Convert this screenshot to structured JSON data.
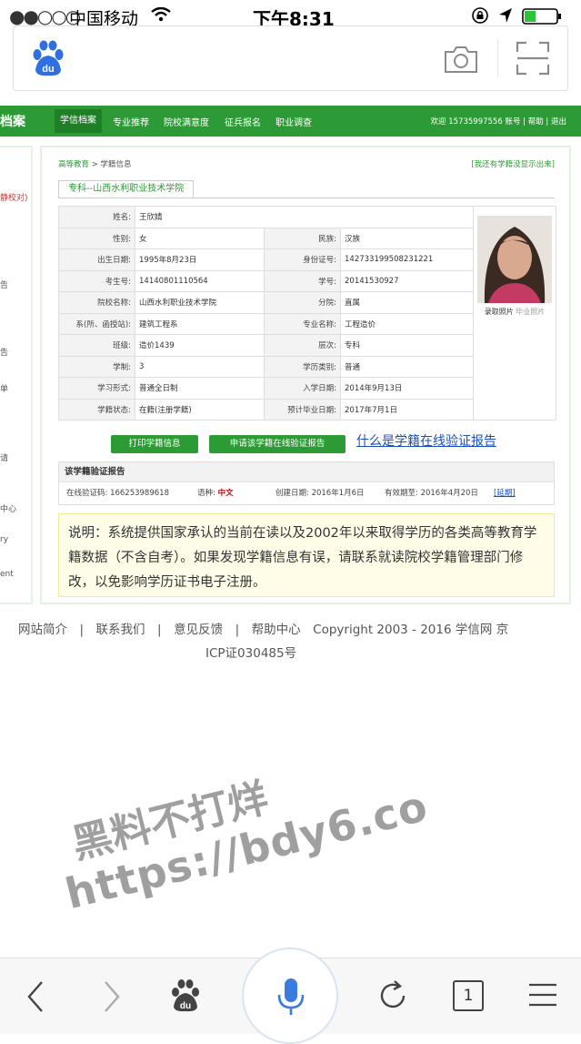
{
  "status_bar": {
    "signal": "●●○○○",
    "carrier": "中国移动",
    "time": "下午8:31"
  },
  "page": {
    "site_name": "档案",
    "nav": [
      "学信档案",
      "专业推荐",
      "院校满意度",
      "征兵报名",
      "职业调查"
    ],
    "user_info": "欢迎 15735997556 账号 | 帮助 | 退出",
    "left_panel": [
      "静校对)",
      "告",
      "告",
      "单",
      "请",
      "中心",
      "ry",
      "ent"
    ],
    "breadcrumb": {
      "home": "高等教育",
      "sep": " > ",
      "current": "学籍信息"
    },
    "no_record_link": "[我还有学籍没显示出来]",
    "school_tab": "专科--山西水利职业技术学院",
    "photo_tabs": {
      "enroll": "录取照片",
      "grad": "毕业照片"
    },
    "rows": [
      {
        "l1": "姓名:",
        "v1": "王欣婧"
      },
      {
        "l1": "性别:",
        "v1": "女",
        "l2": "民族:",
        "v2": "汉族"
      },
      {
        "l1": "出生日期:",
        "v1": "1995年8月23日",
        "l2": "身份证号:",
        "v2": "142733199508231221"
      },
      {
        "l1": "考生号:",
        "v1": "14140801110564",
        "l2": "学号:",
        "v2": "20141530927"
      },
      {
        "l1": "院校名称:",
        "v1": "山西水利职业技术学院",
        "l2": "分院:",
        "v2": "直属"
      },
      {
        "l1": "系(所、函授站):",
        "v1": "建筑工程系",
        "l2": "专业名称:",
        "v2": "工程造价"
      },
      {
        "l1": "班级:",
        "v1": "造价1439",
        "l2": "层次:",
        "v2": "专科"
      },
      {
        "l1": "学制:",
        "v1": "3",
        "l2": "学历类别:",
        "v2": "普通"
      },
      {
        "l1": "学习形式:",
        "v1": "普通全日制",
        "l2": "入学日期:",
        "v2": "2014年9月13日"
      },
      {
        "l1": "学籍状态:",
        "v1": "在籍(注册学籍)",
        "l2": "预计毕业日期:",
        "v2": "2017年7月1日"
      }
    ],
    "buttons": {
      "print": "打印学籍信息",
      "apply": "申请该学籍在线验证报告",
      "what_link": "什么是学籍在线验证报告"
    },
    "verify": {
      "title": "该学籍验证报告",
      "code_label": "在线验证码:",
      "code": "166253989618",
      "lang_label": "语种:",
      "lang": "中文",
      "created_label": "创建日期:",
      "created": "2016年1月6日",
      "expire_label": "有效期至:",
      "expire": "2016年4月20日",
      "extend": "[延期]"
    },
    "notice": "说明：系统提供国家承认的当前在读以及2002年以来取得学历的各类高等教育学籍数据（不含自考）。如果发现学籍信息有误，请联系就读院校学籍管理部门修改，以免影响学历证书电子注册。",
    "footer_row1": "网站简介　|　联系我们　|　意见反馈　|　帮助中心　Copyright 2003 - 2016  学信网 京",
    "footer_row2": "ICP证030485号"
  },
  "watermark": {
    "line1": "黑料不打烊",
    "line2": "https://bdy6.co"
  },
  "toolbar": {
    "tab_count": "1"
  },
  "colors": {
    "green": "#2d9b35",
    "link_blue": "#1a4fc2",
    "notice_bg": "#fffde8"
  }
}
